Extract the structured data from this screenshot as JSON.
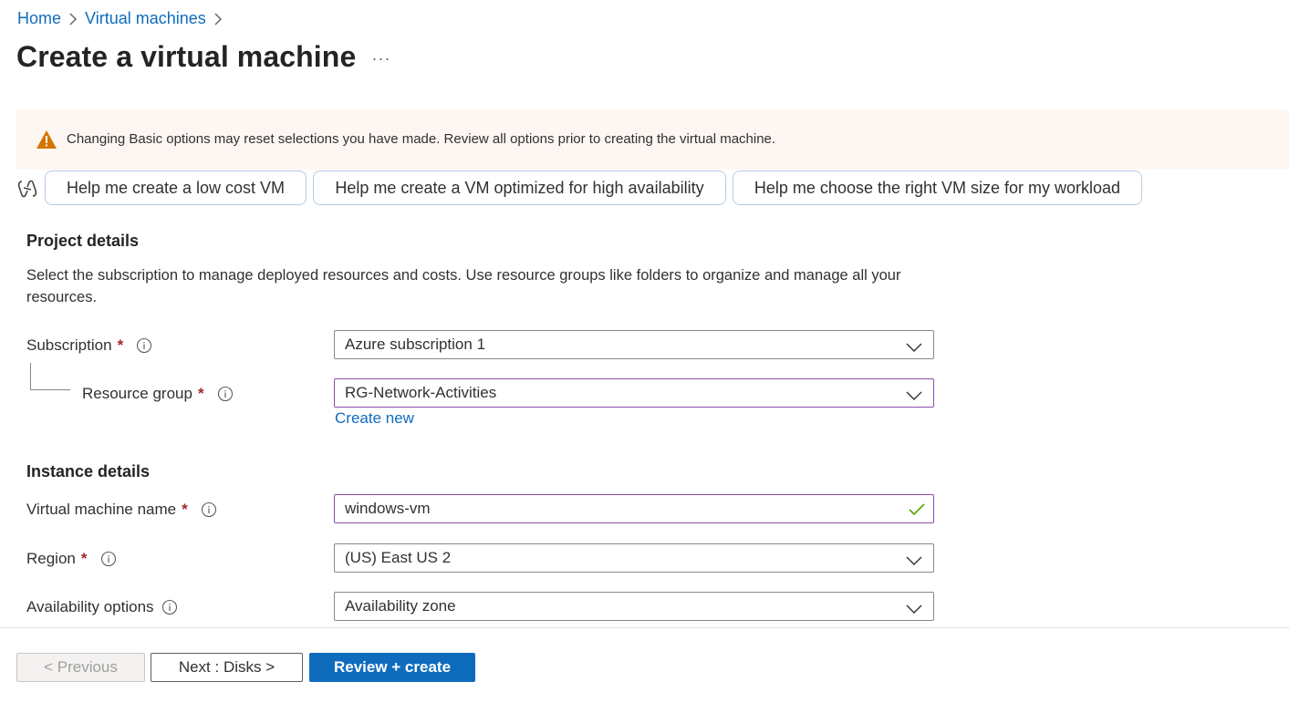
{
  "breadcrumb": {
    "items": [
      {
        "label": "Home"
      },
      {
        "label": "Virtual machines"
      }
    ]
  },
  "page": {
    "title": "Create a virtual machine",
    "more_label": "···"
  },
  "warning": {
    "text": "Changing Basic options may reset selections you have made. Review all options prior to creating the virtual machine.",
    "color": "#d47500"
  },
  "copilot": {
    "suggestions": [
      "Help me create a low cost VM",
      "Help me create a VM optimized for high availability",
      "Help me choose the right VM size for my workload"
    ]
  },
  "project_details": {
    "heading": "Project details",
    "description": "Select the subscription to manage deployed resources and costs. Use resource groups like folders to organize and manage all your resources.",
    "subscription": {
      "label": "Subscription",
      "required": "*",
      "value": "Azure subscription 1"
    },
    "resource_group": {
      "label": "Resource group",
      "required": "*",
      "value": "RG-Network-Activities",
      "create_new": "Create new"
    }
  },
  "instance_details": {
    "heading": "Instance details",
    "vm_name": {
      "label": "Virtual machine name",
      "required": "*",
      "value": "windows-vm",
      "valid": true
    },
    "region": {
      "label": "Region",
      "required": "*",
      "value": "(US) East US 2"
    },
    "availability": {
      "label": "Availability options",
      "value": "Availability zone"
    }
  },
  "footer": {
    "previous": "< Previous",
    "next": "Next : Disks >",
    "review": "Review + create"
  },
  "colors": {
    "link": "#0f6cbd",
    "primary": "#0f6cbd",
    "required": "#a4262c",
    "valid_check": "#57a300",
    "active_border": "#8a4da8"
  }
}
